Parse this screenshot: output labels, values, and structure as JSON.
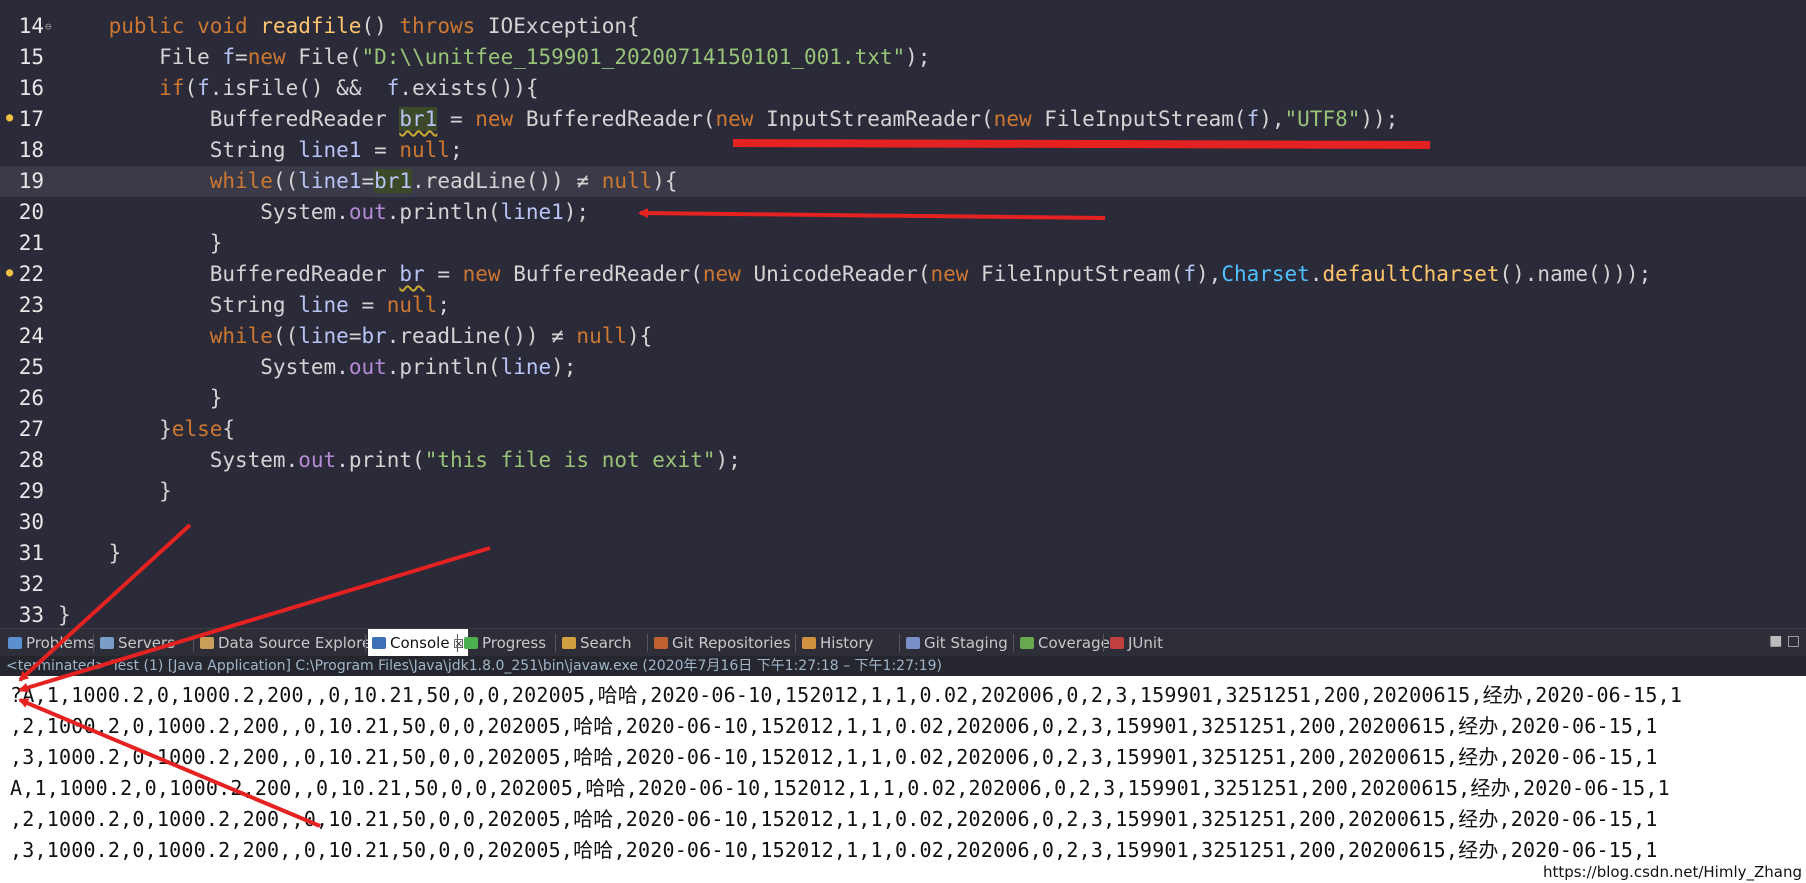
{
  "editor": {
    "lines": [
      {
        "num": "14",
        "fold": true,
        "tokens": [
          [
            "kw",
            "    public "
          ],
          [
            "kw",
            "void "
          ],
          [
            "fn",
            "readfile"
          ],
          [
            "pl",
            "() "
          ],
          [
            "kw",
            "throws "
          ],
          [
            "ty",
            "IOException"
          ],
          [
            "pl",
            "{"
          ]
        ]
      },
      {
        "num": "15",
        "tokens": [
          [
            "ty",
            "        File "
          ],
          [
            "var",
            "f"
          ],
          [
            "pl",
            "="
          ],
          [
            "kw",
            "new "
          ],
          [
            "ty",
            "File"
          ],
          [
            "pl",
            "("
          ],
          [
            "str",
            "\"D:\\\\unitfee_159901_20200714150101_001.txt\""
          ],
          [
            "pl",
            ");"
          ]
        ]
      },
      {
        "num": "16",
        "tokens": [
          [
            "kw",
            "        if"
          ],
          [
            "pl",
            "("
          ],
          [
            "var",
            "f"
          ],
          [
            "pl",
            ".isFile() &&  "
          ],
          [
            "var",
            "f"
          ],
          [
            "pl",
            ".exists()){"
          ]
        ]
      },
      {
        "num": "17",
        "warn": true,
        "tokens": [
          [
            "ty",
            "            BufferedReader "
          ],
          [
            "var hl squig",
            "br1"
          ],
          [
            "pl",
            " = "
          ],
          [
            "kw",
            "new "
          ],
          [
            "ty",
            "BufferedReader"
          ],
          [
            "pl",
            "("
          ],
          [
            "kw",
            "new "
          ],
          [
            "ty",
            "InputStreamReader"
          ],
          [
            "pl",
            "("
          ],
          [
            "kw",
            "new "
          ],
          [
            "ty",
            "FileInputStream"
          ],
          [
            "pl",
            "("
          ],
          [
            "var",
            "f"
          ],
          [
            "pl",
            "),"
          ],
          [
            "str",
            "\"UTF8\""
          ],
          [
            "pl",
            "));"
          ]
        ]
      },
      {
        "num": "18",
        "tokens": [
          [
            "ty",
            "            String "
          ],
          [
            "var",
            "line1"
          ],
          [
            "pl",
            " = "
          ],
          [
            "kw",
            "null"
          ],
          [
            "pl",
            ";"
          ]
        ]
      },
      {
        "num": "19",
        "current": true,
        "tokens": [
          [
            "kw",
            "            while"
          ],
          [
            "pl",
            "(("
          ],
          [
            "var",
            "line1"
          ],
          [
            "pl",
            "="
          ],
          [
            "var hl",
            "br1"
          ],
          [
            "pl",
            ".readLine()) ≠ "
          ],
          [
            "kw",
            "null"
          ],
          [
            "pl",
            "){"
          ]
        ]
      },
      {
        "num": "20",
        "tokens": [
          [
            "ty",
            "                System"
          ],
          [
            "pl",
            "."
          ],
          [
            "fld",
            "out"
          ],
          [
            "pl",
            ".println("
          ],
          [
            "var",
            "line1"
          ],
          [
            "pl",
            ");"
          ]
        ]
      },
      {
        "num": "21",
        "tokens": [
          [
            "pl",
            "            }"
          ]
        ]
      },
      {
        "num": "22",
        "warn": true,
        "tokens": [
          [
            "ty",
            "            BufferedReader "
          ],
          [
            "var squig",
            "br"
          ],
          [
            "pl",
            " = "
          ],
          [
            "kw",
            "new "
          ],
          [
            "ty",
            "BufferedReader"
          ],
          [
            "pl",
            "("
          ],
          [
            "kw",
            "new "
          ],
          [
            "ty",
            "UnicodeReader"
          ],
          [
            "pl",
            "("
          ],
          [
            "kw",
            "new "
          ],
          [
            "ty",
            "FileInputStream"
          ],
          [
            "pl",
            "("
          ],
          [
            "var",
            "f"
          ],
          [
            "pl",
            "),"
          ],
          [
            "cls2",
            "Charset"
          ],
          [
            "pl",
            "."
          ],
          [
            "fn",
            "defaultCharset"
          ],
          [
            "pl",
            "().name()));"
          ]
        ]
      },
      {
        "num": "23",
        "tokens": [
          [
            "ty",
            "            String "
          ],
          [
            "var",
            "line"
          ],
          [
            "pl",
            " = "
          ],
          [
            "kw",
            "null"
          ],
          [
            "pl",
            ";"
          ]
        ]
      },
      {
        "num": "24",
        "tokens": [
          [
            "kw",
            "            while"
          ],
          [
            "pl",
            "(("
          ],
          [
            "var",
            "line"
          ],
          [
            "pl",
            "="
          ],
          [
            "var",
            "br"
          ],
          [
            "pl",
            ".readLine()) ≠ "
          ],
          [
            "kw",
            "null"
          ],
          [
            "pl",
            "){"
          ]
        ]
      },
      {
        "num": "25",
        "tokens": [
          [
            "ty",
            "                System"
          ],
          [
            "pl",
            "."
          ],
          [
            "fld",
            "out"
          ],
          [
            "pl",
            ".println("
          ],
          [
            "var",
            "line"
          ],
          [
            "pl",
            ");"
          ]
        ]
      },
      {
        "num": "26",
        "tokens": [
          [
            "pl",
            "            }"
          ]
        ]
      },
      {
        "num": "27",
        "tokens": [
          [
            "pl",
            "        }"
          ],
          [
            "kw",
            "else"
          ],
          [
            "pl",
            "{"
          ]
        ]
      },
      {
        "num": "28",
        "tokens": [
          [
            "ty",
            "            System"
          ],
          [
            "pl",
            "."
          ],
          [
            "fld",
            "out"
          ],
          [
            "pl",
            ".print("
          ],
          [
            "str",
            "\"this file is not exit\""
          ],
          [
            "pl",
            ");"
          ]
        ]
      },
      {
        "num": "29",
        "tokens": [
          [
            "pl",
            "        }"
          ]
        ]
      },
      {
        "num": "30",
        "tokens": []
      },
      {
        "num": "31",
        "tokens": [
          [
            "pl",
            "    }"
          ]
        ]
      },
      {
        "num": "32",
        "tokens": []
      },
      {
        "num": "33",
        "tokens": [
          [
            "pl",
            "}"
          ]
        ]
      }
    ]
  },
  "tabs": [
    {
      "label": "Problems",
      "icon": "problems-icon",
      "color": "#5a8fd0"
    },
    {
      "label": "Servers",
      "icon": "servers-icon",
      "color": "#7a9ec8"
    },
    {
      "label": "Data Source Explorer",
      "icon": "data-source-icon",
      "color": "#c8a05a"
    },
    {
      "label": "Console",
      "icon": "console-icon",
      "color": "#3b6fb6",
      "active": true,
      "close": "☒"
    },
    {
      "label": "Progress",
      "icon": "progress-icon",
      "color": "#4caf50"
    },
    {
      "label": "Search",
      "icon": "search-icon",
      "color": "#d0a040"
    },
    {
      "label": "Git Repositories",
      "icon": "git-repositories-icon",
      "color": "#c06030"
    },
    {
      "label": "History",
      "icon": "history-icon",
      "color": "#d09040"
    },
    {
      "label": "Git Staging",
      "icon": "git-staging-icon",
      "color": "#7a8ec8"
    },
    {
      "label": "Coverage",
      "icon": "coverage-icon",
      "color": "#6aa84f"
    },
    {
      "label": "JUnit",
      "icon": "junit-icon",
      "color": "#c04040"
    }
  ],
  "window_controls": "■  □",
  "console": {
    "status": "<terminated> Test (1) [Java Application] C:\\Program Files\\Java\\jdk1.8.0_251\\bin\\javaw.exe  (2020年7月16日 下午1:27:18 – 下午1:27:19)",
    "output": [
      "?A,1,1000.2,0,1000.2,200,,0,10.21,50,0,0,202005,哈哈,2020-06-10,152012,1,1,0.02,202006,0,2,3,159901,3251251,200,20200615,经办,2020-06-15,1",
      ",2,1000.2,0,1000.2,200,,0,10.21,50,0,0,202005,哈哈,2020-06-10,152012,1,1,0.02,202006,0,2,3,159901,3251251,200,20200615,经办,2020-06-15,1",
      ",3,1000.2,0,1000.2,200,,0,10.21,50,0,0,202005,哈哈,2020-06-10,152012,1,1,0.02,202006,0,2,3,159901,3251251,200,20200615,经办,2020-06-15,1",
      "A,1,1000.2,0,1000.2,200,,0,10.21,50,0,0,202005,哈哈,2020-06-10,152012,1,1,0.02,202006,0,2,3,159901,3251251,200,20200615,经办,2020-06-15,1",
      ",2,1000.2,0,1000.2,200,,0,10.21,50,0,0,202005,哈哈,2020-06-10,152012,1,1,0.02,202006,0,2,3,159901,3251251,200,20200615,经办,2020-06-15,1",
      ",3,1000.2,0,1000.2,200,,0,10.21,50,0,0,202005,哈哈,2020-06-10,152012,1,1,0.02,202006,0,2,3,159901,3251251,200,20200615,经办,2020-06-15,1"
    ],
    "watermark": "https://blog.csdn.net/Himly_Zhang"
  },
  "annotation_color": "#e52222"
}
